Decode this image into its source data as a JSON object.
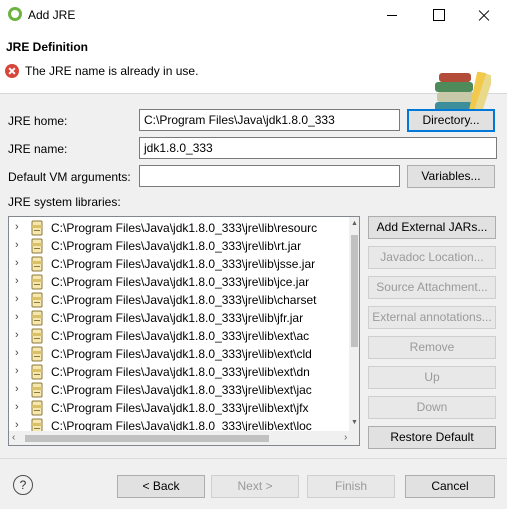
{
  "window": {
    "title": "Add JRE",
    "app_icon": "spring-leaf-icon"
  },
  "header": {
    "title": "JRE Definition",
    "error_icon": "error-icon",
    "message": "The JRE name is already in use.",
    "banner_icon": "library-books-icon"
  },
  "form": {
    "jre_home_label": "JRE home:",
    "jre_home_value": "C:\\Program Files\\Java\\jdk1.8.0_333",
    "directory_button": "Directory...",
    "jre_name_label": "JRE name:",
    "jre_name_value": "jdk1.8.0_333",
    "vm_args_label": "Default VM arguments:",
    "vm_args_value": "",
    "variables_button": "Variables...",
    "libraries_label": "JRE system libraries:"
  },
  "libraries": [
    "C:\\Program Files\\Java\\jdk1.8.0_333\\jre\\lib\\resourc",
    "C:\\Program Files\\Java\\jdk1.8.0_333\\jre\\lib\\rt.jar",
    "C:\\Program Files\\Java\\jdk1.8.0_333\\jre\\lib\\jsse.jar",
    "C:\\Program Files\\Java\\jdk1.8.0_333\\jre\\lib\\jce.jar",
    "C:\\Program Files\\Java\\jdk1.8.0_333\\jre\\lib\\charset",
    "C:\\Program Files\\Java\\jdk1.8.0_333\\jre\\lib\\jfr.jar",
    "C:\\Program Files\\Java\\jdk1.8.0_333\\jre\\lib\\ext\\ac",
    "C:\\Program Files\\Java\\jdk1.8.0_333\\jre\\lib\\ext\\cld",
    "C:\\Program Files\\Java\\jdk1.8.0_333\\jre\\lib\\ext\\dn",
    "C:\\Program Files\\Java\\jdk1.8.0_333\\jre\\lib\\ext\\jac",
    "C:\\Program Files\\Java\\jdk1.8.0_333\\jre\\lib\\ext\\jfx",
    "C:\\Program Files\\Java\\jdk1.8.0_333\\jre\\lib\\ext\\loc"
  ],
  "side_buttons": {
    "add_external_jars": "Add External JARs...",
    "javadoc_location": "Javadoc Location...",
    "source_attachment": "Source Attachment...",
    "external_annotations": "External annotations...",
    "remove": "Remove",
    "up": "Up",
    "down": "Down",
    "restore_default": "Restore Default"
  },
  "footer": {
    "help_icon": "help-icon",
    "help_glyph": "?",
    "back": "< Back",
    "next": "Next >",
    "finish": "Finish",
    "cancel": "Cancel"
  },
  "colors": {
    "accent": "#0078d7",
    "error": "#d8453b",
    "disabled_text": "#9a9a9a"
  }
}
